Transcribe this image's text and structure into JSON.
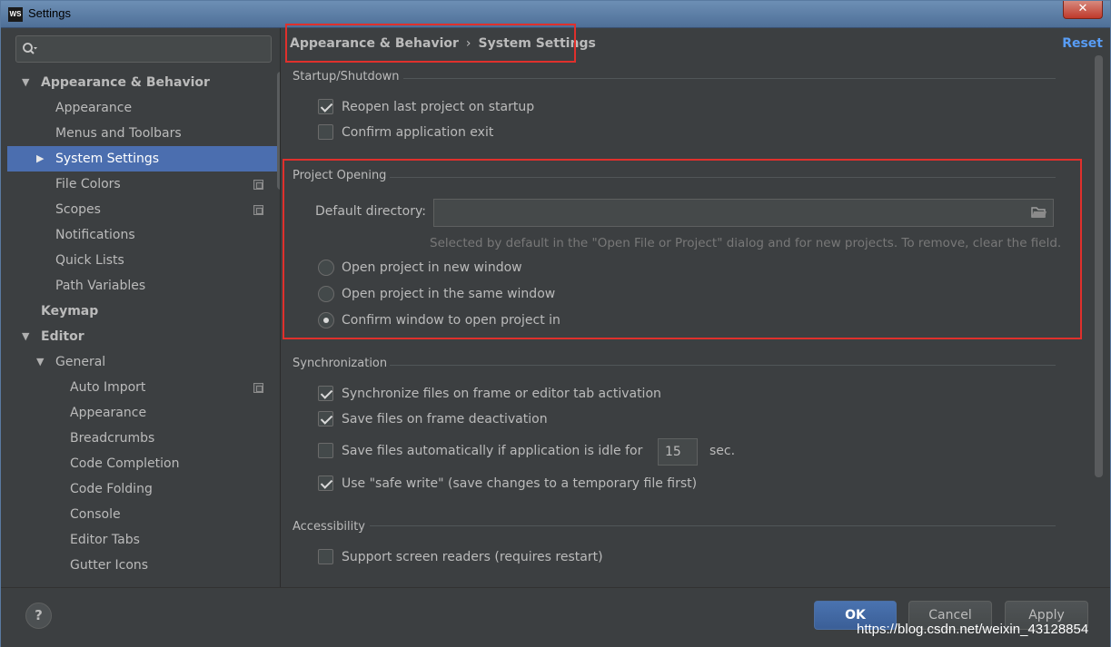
{
  "window": {
    "title": "Settings",
    "app_icon_text": "WS",
    "close_label": "✕"
  },
  "sidebar": {
    "search_placeholder": "",
    "items": [
      {
        "label": "Appearance & Behavior",
        "level": 0,
        "bold": true,
        "expanded": true,
        "has_arrow": true
      },
      {
        "label": "Appearance",
        "level": 1
      },
      {
        "label": "Menus and Toolbars",
        "level": 1
      },
      {
        "label": "System Settings",
        "level": 1,
        "selected": true,
        "has_arrow": true,
        "expanded": false
      },
      {
        "label": "File Colors",
        "level": 1,
        "project_icon": true
      },
      {
        "label": "Scopes",
        "level": 1,
        "project_icon": true
      },
      {
        "label": "Notifications",
        "level": 1
      },
      {
        "label": "Quick Lists",
        "level": 1
      },
      {
        "label": "Path Variables",
        "level": 1
      },
      {
        "label": "Keymap",
        "level": 0,
        "bold": true
      },
      {
        "label": "Editor",
        "level": 0,
        "bold": true,
        "expanded": true,
        "has_arrow": true
      },
      {
        "label": "General",
        "level": 1,
        "expanded": true,
        "has_arrow": true
      },
      {
        "label": "Auto Import",
        "level": 2,
        "project_icon": true
      },
      {
        "label": "Appearance",
        "level": 2
      },
      {
        "label": "Breadcrumbs",
        "level": 2
      },
      {
        "label": "Code Completion",
        "level": 2
      },
      {
        "label": "Code Folding",
        "level": 2
      },
      {
        "label": "Console",
        "level": 2
      },
      {
        "label": "Editor Tabs",
        "level": 2
      },
      {
        "label": "Gutter Icons",
        "level": 2
      }
    ]
  },
  "main": {
    "breadcrumb": [
      "Appearance & Behavior",
      "System Settings"
    ],
    "breadcrumb_sep": "›",
    "reset_label": "Reset",
    "startup": {
      "title": "Startup/Shutdown",
      "reopen_last": {
        "label": "Reopen last project on startup",
        "checked": true
      },
      "confirm_exit": {
        "label": "Confirm application exit",
        "checked": false
      }
    },
    "project_opening": {
      "title": "Project Opening",
      "default_dir_label": "Default directory:",
      "default_dir_value": "",
      "hint": "Selected by default in the \"Open File or Project\" dialog and for new projects. To remove, clear the field.",
      "options": [
        {
          "label": "Open project in new window",
          "checked": false
        },
        {
          "label": "Open project in the same window",
          "checked": false
        },
        {
          "label": "Confirm window to open project in",
          "checked": true
        }
      ]
    },
    "sync": {
      "title": "Synchronization",
      "sync_files": {
        "label": "Synchronize files on frame or editor tab activation",
        "checked": true
      },
      "save_deactivation": {
        "label": "Save files on frame deactivation",
        "checked": true
      },
      "save_idle": {
        "label": "Save files automatically if application is idle for",
        "checked": false
      },
      "idle_seconds": "15",
      "sec_label": "sec.",
      "safe_write": {
        "label": "Use \"safe write\" (save changes to a temporary file first)",
        "checked": true
      }
    },
    "accessibility": {
      "title": "Accessibility",
      "screen_readers": {
        "label": "Support screen readers (requires restart)",
        "checked": false
      }
    }
  },
  "buttons": {
    "help": "?",
    "ok": "OK",
    "cancel": "Cancel",
    "apply": "Apply"
  },
  "watermark": "https://blog.csdn.net/weixin_43128854",
  "colors": {
    "background": "#3c3f41",
    "selection": "#4b6eaf",
    "link": "#589df6",
    "highlight_box": "#e0302c"
  }
}
